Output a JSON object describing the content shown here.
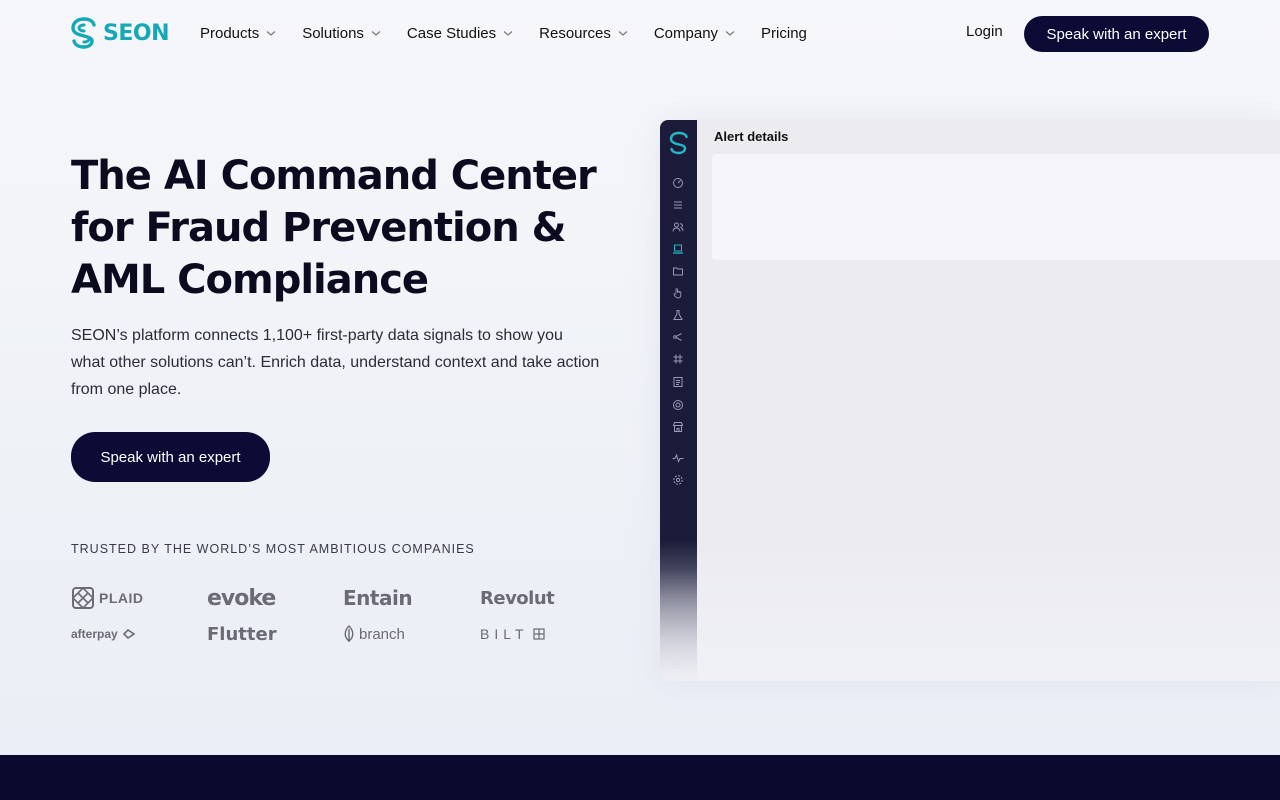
{
  "brand": {
    "name": "SEON",
    "accent": "#17a8b8",
    "dark": "#0b0b35"
  },
  "nav": {
    "items": [
      {
        "label": "Products",
        "has_menu": true
      },
      {
        "label": "Solutions",
        "has_menu": true
      },
      {
        "label": "Case Studies",
        "has_menu": true
      },
      {
        "label": "Resources",
        "has_menu": true
      },
      {
        "label": "Company",
        "has_menu": true
      },
      {
        "label": "Pricing",
        "has_menu": false
      }
    ],
    "login": "Login",
    "cta": "Speak with an expert"
  },
  "hero": {
    "title": "The AI Command Center for Fraud Prevention & AML Compliance",
    "description": "SEON’s platform connects 1,100+ first-party data signals to show you what other solutions can’t. Enrich data, understand context and take action from one place.",
    "cta": "Speak with an expert"
  },
  "trusted": {
    "heading": "TRUSTED BY THE WORLD’S MOST AMBITIOUS COMPANIES",
    "logos": [
      "PLAID",
      "evoke",
      "Entain",
      "Revolut",
      "afterpay",
      "Flutter",
      "branch",
      "BILT"
    ]
  },
  "app_preview": {
    "title": "Alert details",
    "rail_icons": [
      "dashboard-icon",
      "list-icon",
      "users-icon",
      "monitor-icon",
      "folder-icon",
      "hand-icon",
      "flask-icon",
      "share-icon",
      "hash-icon",
      "document-icon",
      "target-icon",
      "store-icon",
      "activity-icon",
      "settings-icon",
      "collapse-icon"
    ]
  }
}
